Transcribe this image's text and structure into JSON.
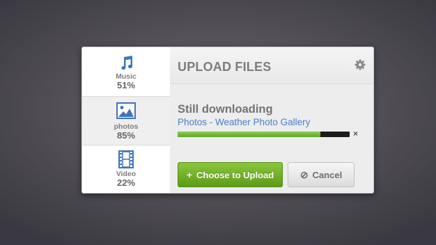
{
  "sidebar": {
    "items": [
      {
        "icon": "music-note-icon",
        "label": "Music",
        "percent": "51%"
      },
      {
        "icon": "image-icon",
        "label": "photos",
        "percent": "85%"
      },
      {
        "icon": "film-strip-icon",
        "label": "Video",
        "percent": "22%"
      }
    ]
  },
  "header": {
    "title": "UPLOAD FILES",
    "settings_icon": "gear-icon"
  },
  "status": {
    "heading": "Still downloading",
    "file": "Photos - Weather Photo Gallery",
    "progress": 0.83,
    "close_symbol": "×"
  },
  "buttons": {
    "upload_label": "Choose to Upload",
    "upload_glyph": "+",
    "cancel_label": "Cancel",
    "cancel_glyph": "⊘"
  },
  "colors": {
    "accent_blue": "#4a7fc8",
    "progress_green": "#6fb83a",
    "upload_green": "#7ab830"
  }
}
